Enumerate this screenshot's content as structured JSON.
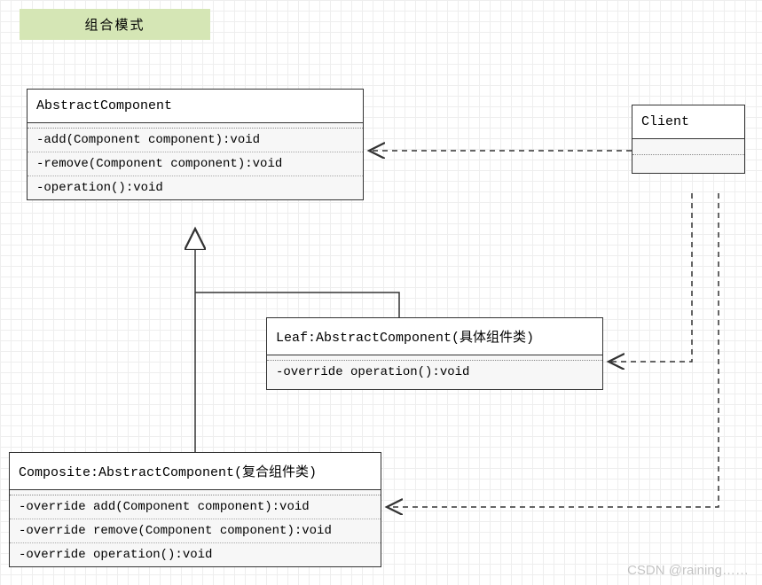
{
  "title": "组合模式",
  "watermark": "CSDN @raining……",
  "abstract_component": {
    "name": "AbstractComponent",
    "ops": [
      "-add(Component component):void",
      "-remove(Component component):void",
      "-operation():void"
    ]
  },
  "client": {
    "name": "Client"
  },
  "leaf": {
    "name": "Leaf:AbstractComponent(具体组件类)",
    "ops": [
      "-override operation():void"
    ]
  },
  "composite": {
    "name": "Composite:AbstractComponent(复合组件类)",
    "ops": [
      "-override add(Component component):void",
      "-override remove(Component component):void",
      "-override operation():void"
    ]
  },
  "relations": [
    {
      "from": "Client",
      "to": "AbstractComponent",
      "type": "dependency"
    },
    {
      "from": "Client",
      "to": "Leaf",
      "type": "dependency"
    },
    {
      "from": "Client",
      "to": "Composite",
      "type": "dependency"
    },
    {
      "from": "Leaf",
      "to": "AbstractComponent",
      "type": "generalization"
    },
    {
      "from": "Composite",
      "to": "AbstractComponent",
      "type": "generalization"
    }
  ]
}
